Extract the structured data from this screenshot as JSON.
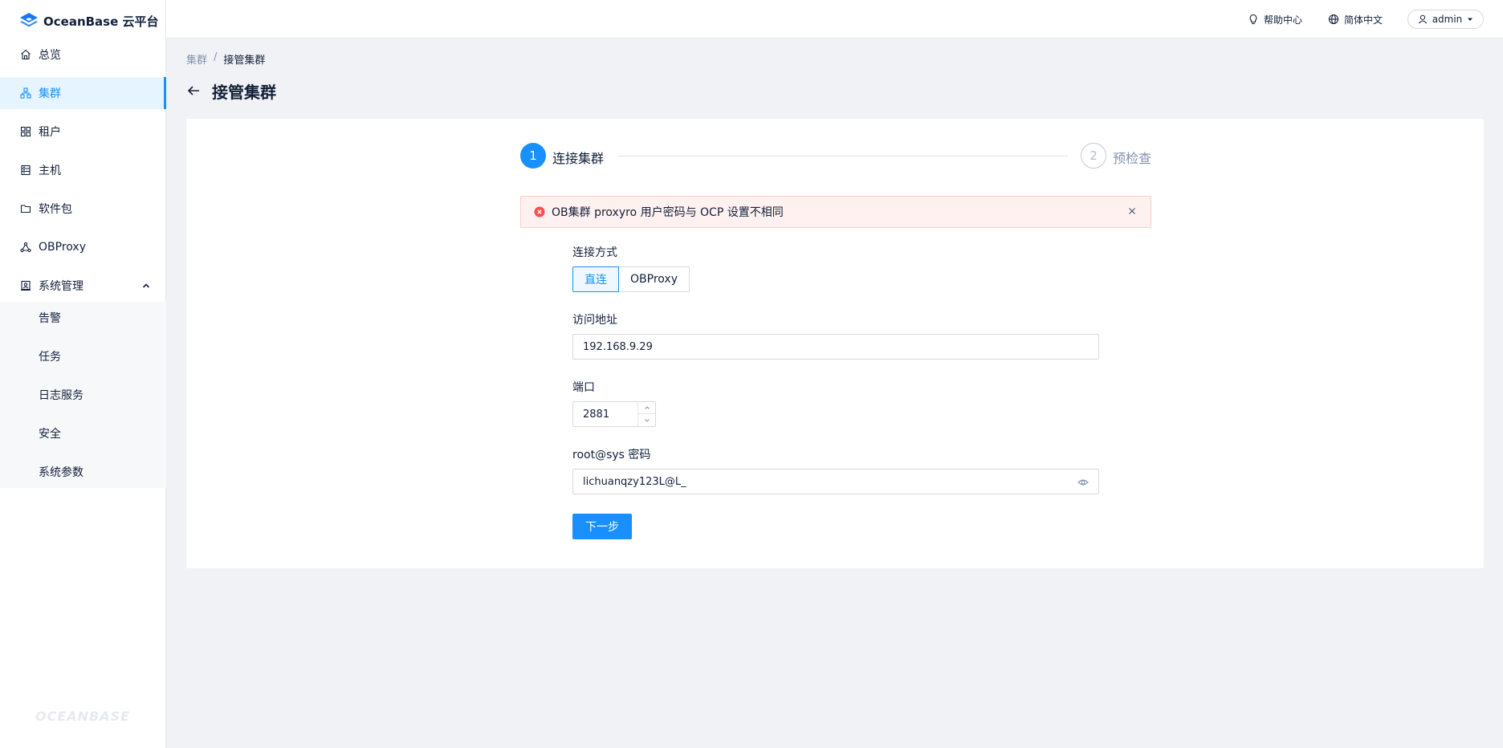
{
  "brand": {
    "name": "OceanBase 云平台",
    "watermark": "OCEANBASE"
  },
  "sidebar": {
    "items": [
      {
        "label": "总览",
        "icon": "home-icon"
      },
      {
        "label": "集群",
        "icon": "cluster-icon",
        "active": true
      },
      {
        "label": "租户",
        "icon": "grid-icon"
      },
      {
        "label": "主机",
        "icon": "server-icon"
      },
      {
        "label": "软件包",
        "icon": "folder-icon"
      },
      {
        "label": "OBProxy",
        "icon": "proxy-icon"
      },
      {
        "label": "系统管理",
        "icon": "system-icon",
        "expanded": true
      }
    ],
    "subitems": [
      "告警",
      "任务",
      "日志服务",
      "安全",
      "系统参数"
    ]
  },
  "header": {
    "help": "帮助中心",
    "language": "简体中文",
    "user": "admin"
  },
  "breadcrumb": {
    "parent": "集群",
    "separator": "/",
    "current": "接管集群"
  },
  "page": {
    "title": "接管集群"
  },
  "steps": [
    {
      "num": "1",
      "label": "连接集群"
    },
    {
      "num": "2",
      "label": "预检查"
    }
  ],
  "alert": {
    "message": "OB集群 proxyro 用户密码与 OCP 设置不相同"
  },
  "form": {
    "mode": {
      "label": "连接方式",
      "options": [
        "直连",
        "OBProxy"
      ],
      "selected": "直连"
    },
    "address": {
      "label": "访问地址",
      "value": "192.168.9.29"
    },
    "port": {
      "label": "端口",
      "value": "2881"
    },
    "password": {
      "label": "root@sys 密码",
      "value": "lichuanqzy123L@L_"
    },
    "next": "下一步"
  },
  "colors": {
    "primary": "#1890ff",
    "error": "#ff4d4f",
    "alert_bg": "#fff1f0"
  }
}
